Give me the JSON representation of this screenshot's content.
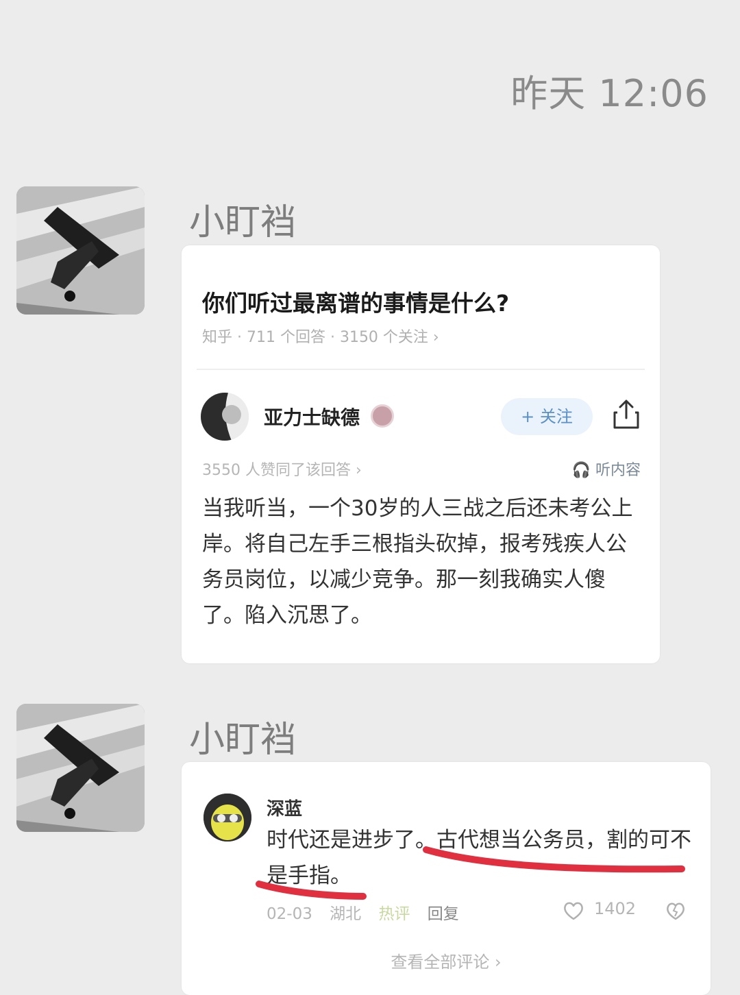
{
  "chat": {
    "timestamp": "昨天 12:06",
    "messages": [
      {
        "sender": "小盯裆",
        "card": {
          "question_title": "你们听过最离谱的事情是什么?",
          "question_meta": "知乎 · 711 个回答 · 3150 个关注 ›",
          "author_name": "亚力士缺德",
          "follow_label": "+ 关注",
          "votes_text": "3550 人赞同了该回答 ›",
          "listen_label": "听内容",
          "answer_text": "当我听当，一个30岁的人三战之后还未考公上岸。将自己左手三根指头砍掉，报考残疾人公务员岗位，以减少竞争。那一刻我确实人傻了。陷入沉思了。"
        }
      },
      {
        "sender": "小盯裆",
        "card": {
          "commenter_name": "深蓝",
          "comment_text": "时代还是进步了。古代想当公务员，割的可不是手指。",
          "date": "02-03",
          "location": "湖北",
          "hot_label": "热评",
          "reply_label": "回复",
          "like_count": "1402",
          "view_all_label": "查看全部评论 ›"
        }
      }
    ]
  },
  "icons": [
    "share-icon",
    "headphones-icon",
    "heart-icon",
    "dislike-icon"
  ],
  "colors": {
    "background": "#ececec",
    "card": "#ffffff",
    "follow_accent": "#5a90c7",
    "underline": "#e03040"
  }
}
